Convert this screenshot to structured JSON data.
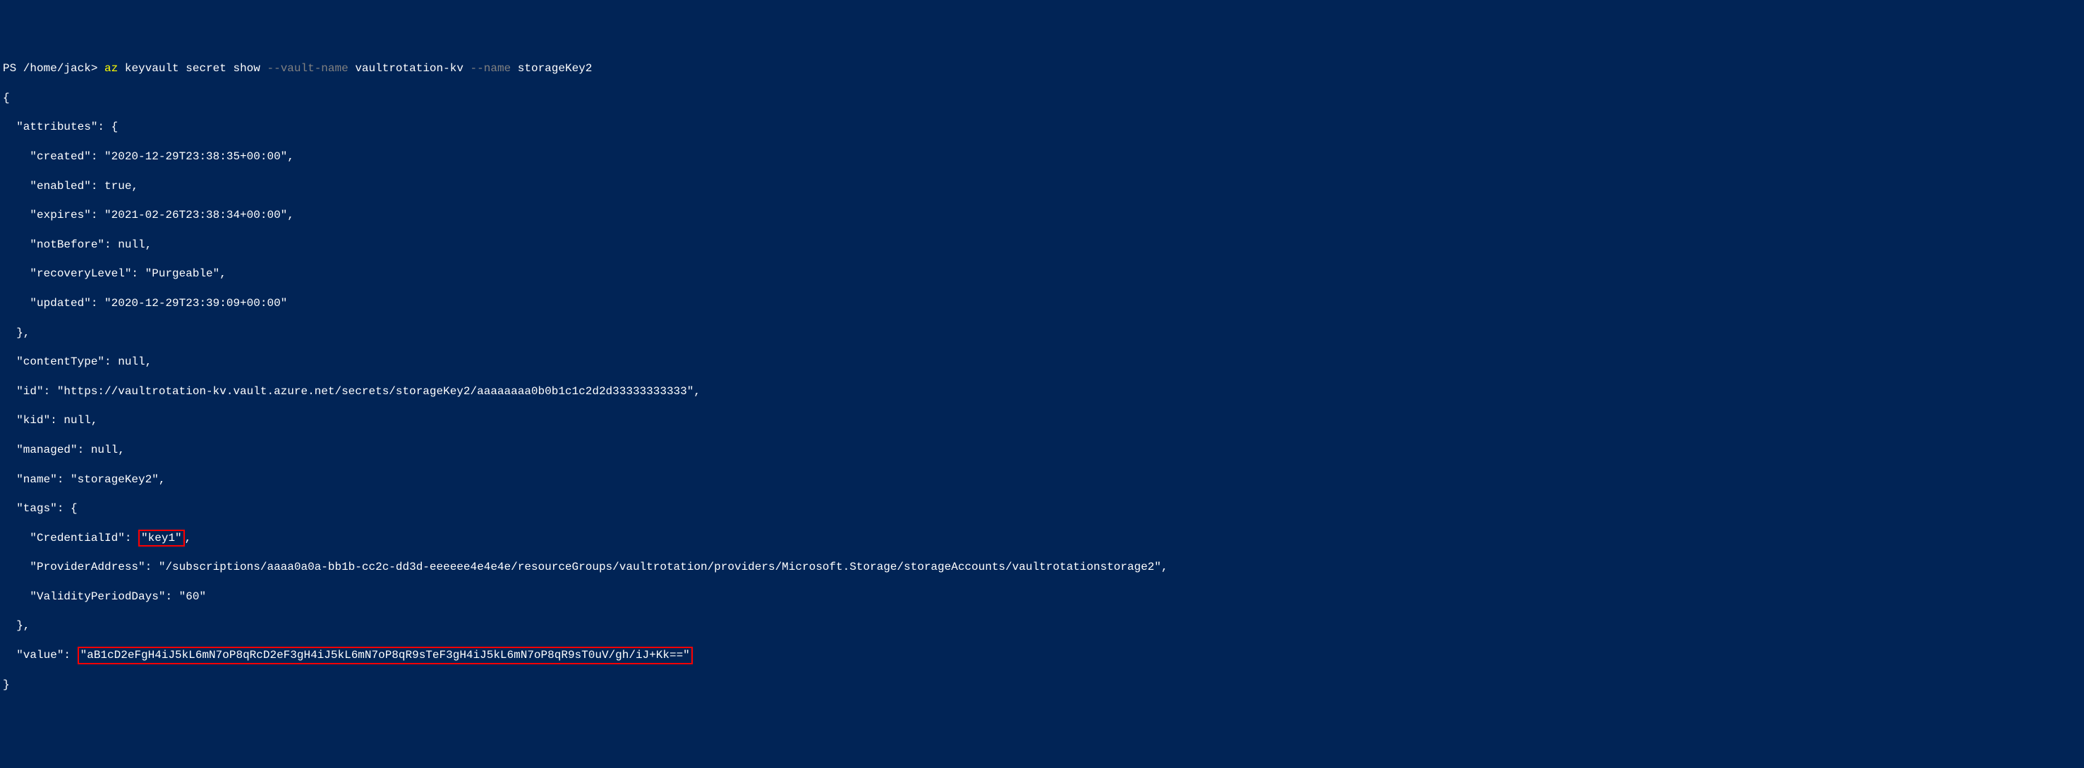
{
  "prompt": {
    "prefix": "PS /home/jack> ",
    "cmd_az": "az ",
    "cmd_rest": "keyvault secret show ",
    "flag1": "--vault-name ",
    "arg1": "vaultrotation-kv ",
    "flag2": "--name ",
    "arg2": "storageKey2"
  },
  "output": {
    "l01": "{",
    "l02": "  \"attributes\": {",
    "l03": "    \"created\": \"2020-12-29T23:38:35+00:00\",",
    "l04": "    \"enabled\": true,",
    "l05": "    \"expires\": \"2021-02-26T23:38:34+00:00\",",
    "l06": "    \"notBefore\": null,",
    "l07": "    \"recoveryLevel\": \"Purgeable\",",
    "l08": "    \"updated\": \"2020-12-29T23:39:09+00:00\"",
    "l09": "  },",
    "l10": "  \"contentType\": null,",
    "l11": "  \"id\": \"https://vaultrotation-kv.vault.azure.net/secrets/storageKey2/aaaaaaaa0b0b1c1c2d2d33333333333\",",
    "l12": "  \"kid\": null,",
    "l13": "  \"managed\": null,",
    "l14": "  \"name\": \"storageKey2\",",
    "l15": "  \"tags\": {",
    "l16a": "    \"CredentialId\": ",
    "l16b": "\"key1\"",
    "l16c": ",",
    "l17": "    \"ProviderAddress\": \"/subscriptions/aaaa0a0a-bb1b-cc2c-dd3d-eeeeee4e4e4e/resourceGroups/vaultrotation/providers/Microsoft.Storage/storageAccounts/vaultrotationstorage2\",",
    "l18": "    \"ValidityPeriodDays\": \"60\"",
    "l19": "  },",
    "l20a": "  \"value\": ",
    "l20b": "\"aB1cD2eFgH4iJ5kL6mN7oP8qRcD2eF3gH4iJ5kL6mN7oP8qR9sTeF3gH4iJ5kL6mN7oP8qR9sT0uV/gh/iJ+Kk==\"",
    "l21": "}"
  }
}
